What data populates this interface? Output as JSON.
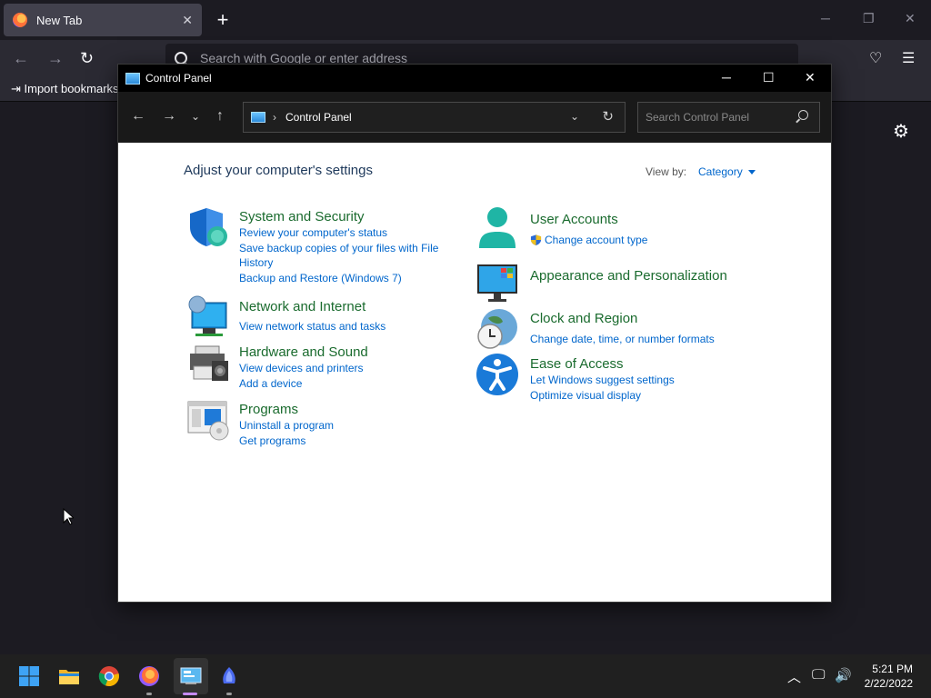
{
  "browser": {
    "tab_title": "New Tab",
    "url_placeholder": "Search with Google or enter address",
    "import_bookmarks": "Import bookmarks..."
  },
  "window": {
    "title": "Control Panel",
    "address": "Control Panel",
    "search_placeholder": "Search Control Panel"
  },
  "control_panel": {
    "heading": "Adjust your computer's settings",
    "view_by_label": "View by:",
    "view_by_value": "Category",
    "left": [
      {
        "title": "System and Security",
        "icon": "shield-icon",
        "links": [
          "Review your computer's status",
          "Save backup copies of your files with File",
          "History",
          "Backup and Restore (Windows 7)"
        ]
      },
      {
        "title": "Network and Internet",
        "icon": "network-icon",
        "links": [
          "View network status and tasks"
        ]
      },
      {
        "title": "Hardware and Sound",
        "icon": "printer-icon",
        "links": [
          "View devices and printers",
          "Add a device"
        ]
      },
      {
        "title": "Programs",
        "icon": "programs-icon",
        "links": [
          "Uninstall a program",
          "Get programs"
        ]
      }
    ],
    "right": [
      {
        "title": "User Accounts",
        "icon": "user-icon",
        "links": [
          "Change account type"
        ]
      },
      {
        "title": "Appearance and Personalization",
        "icon": "monitor-icon",
        "links": []
      },
      {
        "title": "Clock and Region",
        "icon": "clock-globe-icon",
        "links": [
          "Change date, time, or number formats"
        ]
      },
      {
        "title": "Ease of Access",
        "icon": "accessibility-icon",
        "links": [
          "Let Windows suggest settings",
          "Optimize visual display"
        ]
      }
    ]
  },
  "taskbar": {
    "time": "5:21 PM",
    "date": "2/22/2022"
  },
  "colors": {
    "category_title": "#1a6b2e",
    "link": "#0066cc",
    "heading": "#1e395b"
  }
}
